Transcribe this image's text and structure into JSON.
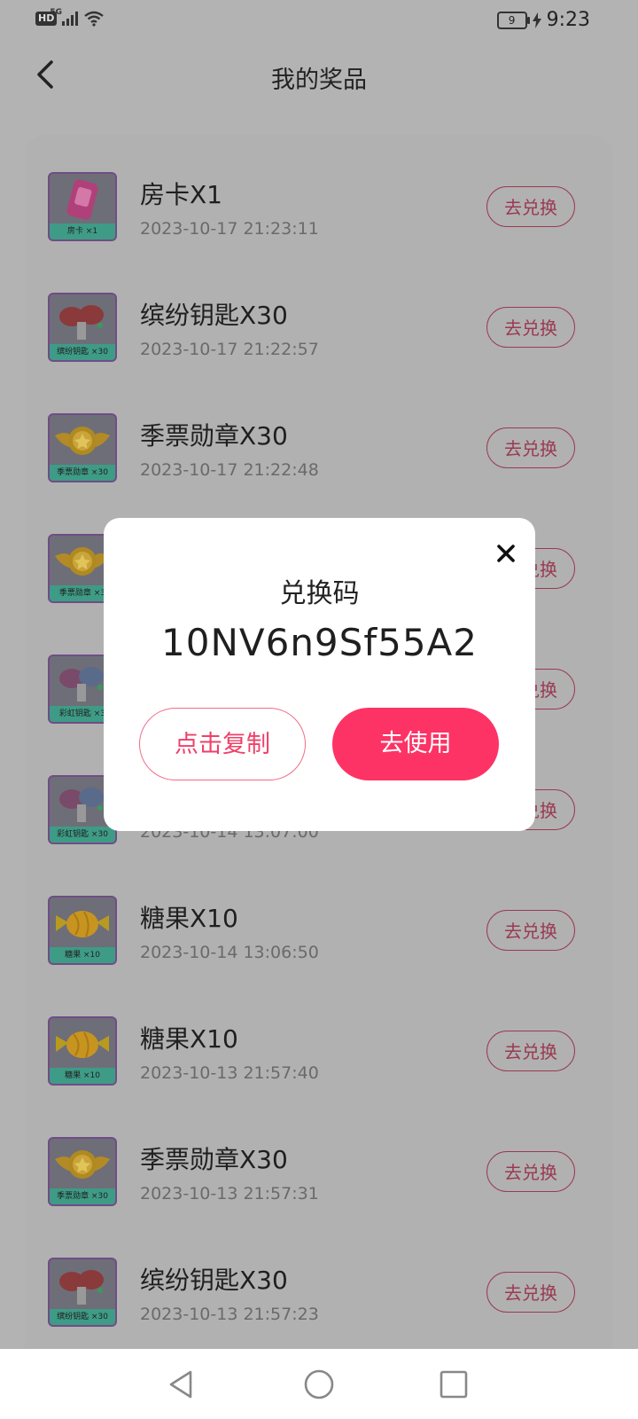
{
  "status_bar": {
    "hd": "HD",
    "network": "5G",
    "battery": "9",
    "time": "9:23"
  },
  "header": {
    "title": "我的奖品"
  },
  "prizes": [
    {
      "name": "房卡X1",
      "date": "2023-10-17 21:23:11",
      "caption": "房卡 ×1",
      "button": "去兑换",
      "icon": "room-card-icon"
    },
    {
      "name": "缤纷钥匙X30",
      "date": "2023-10-17 21:22:57",
      "caption": "缤纷钥匙 ×30",
      "button": "去兑换",
      "icon": "colorful-key-icon"
    },
    {
      "name": "季票勋章X30",
      "date": "2023-10-17 21:22:48",
      "caption": "季票勋章 ×30",
      "button": "去兑换",
      "icon": "season-medal-icon"
    },
    {
      "name": "",
      "date": "",
      "caption": "季票勋章 ×3",
      "button": "去兑换",
      "icon": "season-medal-icon"
    },
    {
      "name": "",
      "date": "",
      "caption": "彩虹钥匙 ×3",
      "button": "去兑换",
      "icon": "rainbow-key-icon"
    },
    {
      "name": "",
      "date": "2023-10-14 13:07:00",
      "caption": "彩虹钥匙 ×30",
      "button": "去兑换",
      "icon": "rainbow-key-icon"
    },
    {
      "name": "糖果X10",
      "date": "2023-10-14 13:06:50",
      "caption": "糖果 ×10",
      "button": "去兑换",
      "icon": "candy-icon"
    },
    {
      "name": "糖果X10",
      "date": "2023-10-13 21:57:40",
      "caption": "糖果 ×10",
      "button": "去兑换",
      "icon": "candy-icon"
    },
    {
      "name": "季票勋章X30",
      "date": "2023-10-13 21:57:31",
      "caption": "季票勋章 ×30",
      "button": "去兑换",
      "icon": "season-medal-icon"
    },
    {
      "name": "缤纷钥匙X30",
      "date": "2023-10-13 21:57:23",
      "caption": "缤纷钥匙 ×30",
      "button": "去兑换",
      "icon": "colorful-key-icon"
    }
  ],
  "modal": {
    "title": "兑换码",
    "code": "10NV6n9Sf55A2",
    "copy_button": "点击复制",
    "use_button": "去使用"
  },
  "colors": {
    "accent": "#fd3366",
    "overlay": "#b3b3b3"
  }
}
